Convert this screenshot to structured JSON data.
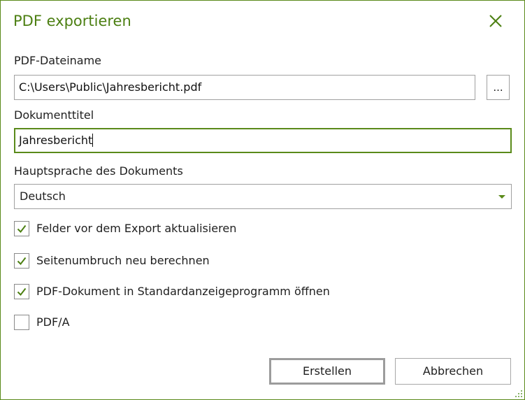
{
  "dialog": {
    "title": "PDF exportieren",
    "accent_color": "#5a8a1a"
  },
  "filename": {
    "label": "PDF-Dateiname",
    "value": "C:\\Users\\Public\\Jahresbericht.pdf",
    "browse_label": "..."
  },
  "doc_title": {
    "label": "Dokumenttitel",
    "value": "Jahresbericht"
  },
  "language": {
    "label": "Hauptsprache des Dokuments",
    "selected": "Deutsch"
  },
  "options": [
    {
      "label": "Felder vor dem Export aktualisieren",
      "checked": true
    },
    {
      "label": "Seitenumbruch neu berechnen",
      "checked": true
    },
    {
      "label": "PDF-Dokument in Standardanzeigeprogramm öffnen",
      "checked": true
    },
    {
      "label": "PDF/A",
      "checked": false
    }
  ],
  "buttons": {
    "create": "Erstellen",
    "cancel": "Abbrechen"
  },
  "icons": {
    "close": "close-icon",
    "dropdown": "chevron-down-icon",
    "check": "checkmark-icon",
    "resize": "resize-grip-icon"
  }
}
